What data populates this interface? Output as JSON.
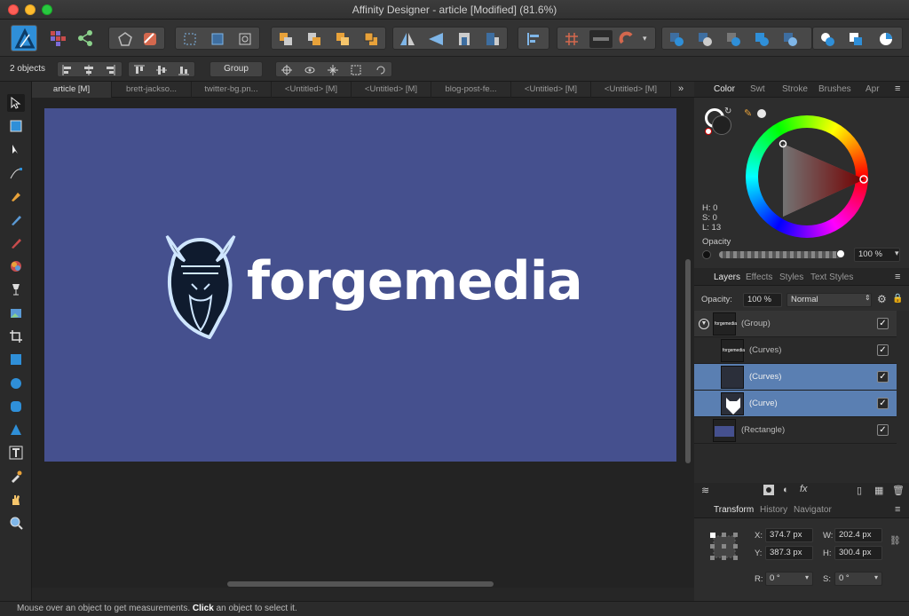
{
  "window": {
    "title": "Affinity Designer - article [Modified] (81.6%)"
  },
  "context_bar": {
    "selection_count": "2 objects",
    "group_label": "Group"
  },
  "doc_tabs": [
    "article [M]",
    "brett-jackso...",
    "twitter-bg.pn...",
    "<Untitled> [M]",
    "<Untitled> [M]",
    "blog-post-fe...",
    "<Untitled> [M]",
    "<Untitled> [M]"
  ],
  "canvas": {
    "brand_text": "forgemedia",
    "artboard_color": "#45508e"
  },
  "color_panel": {
    "tabs": [
      "Color",
      "Swt",
      "Stroke",
      "Brushes",
      "Apr"
    ],
    "h": "H: 0",
    "s": "S: 0",
    "l": "L: 13",
    "opacity_label": "Opacity",
    "opacity_value": "100 %"
  },
  "layers_panel": {
    "tabs": [
      "Layers",
      "Effects",
      "Styles",
      "Text Styles"
    ],
    "opacity_label": "Opacity:",
    "opacity_value": "100 %",
    "blend_mode": "Normal",
    "thumb_text": "forgemedia",
    "layers": [
      {
        "name": "(Group)"
      },
      {
        "name": "(Curves)"
      },
      {
        "name": "(Curves)"
      },
      {
        "name": "(Curve)"
      },
      {
        "name": "(Rectangle)"
      }
    ]
  },
  "transform_panel": {
    "tabs": [
      "Transform",
      "History",
      "Navigator"
    ],
    "x_label": "X:",
    "x": "374.7 px",
    "y_label": "Y:",
    "y": "387.3 px",
    "w_label": "W:",
    "w": "202.4 px",
    "h_label": "H:",
    "h": "300.4 px",
    "r_label": "R:",
    "r": "0 °",
    "s_label": "S:",
    "s": "0 °"
  },
  "status": {
    "pre": "Mouse over an object to get measurements. ",
    "bold": "Click",
    "post": " an object to select it."
  },
  "colors": {
    "accent_blue": "#2f8fd8",
    "selection_row": "#5a7fb2",
    "orange": "#e8a23a"
  }
}
